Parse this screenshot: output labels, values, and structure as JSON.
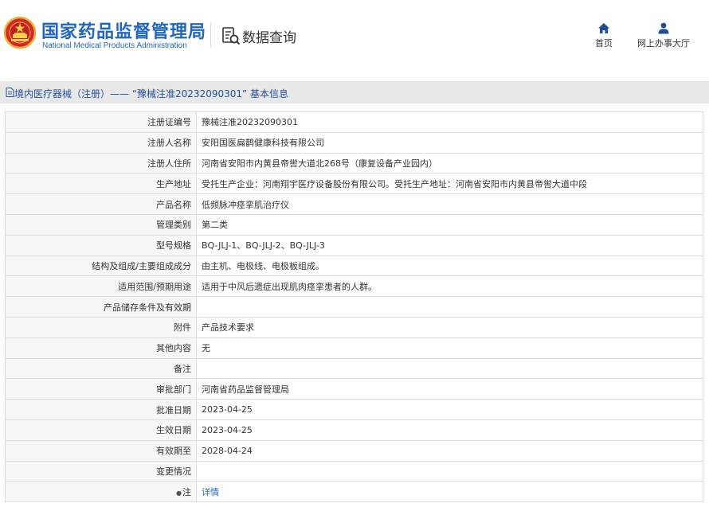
{
  "header": {
    "title_cn": "国家药品监督管理局",
    "title_en": "National Medical Products Administration",
    "query_title": "数据查询",
    "nav": {
      "home": "首页",
      "service_hall": "网上办事大厅"
    }
  },
  "breadcrumb": {
    "text": "境内医疗器械（注册）—— “豫械注准20232090301” 基本信息"
  },
  "rows": [
    {
      "label": "注册证编号",
      "value": "豫械注准20232090301"
    },
    {
      "label": "注册人名称",
      "value": "安阳国医扁鹊健康科技有限公司"
    },
    {
      "label": "注册人住所",
      "value": "河南省安阳市内黄县帝喾大道北268号（康复设备产业园内）"
    },
    {
      "label": "生产地址",
      "value": "受托生产企业：河南翔宇医疗设备股份有限公司。受托生产地址：河南省安阳市内黄县帝喾大道中段"
    },
    {
      "label": "产品名称",
      "value": "低频脉冲痉挛肌治疗仪"
    },
    {
      "label": "管理类别",
      "value": "第二类"
    },
    {
      "label": "型号规格",
      "value": "BQ-JLJ-1、BQ-JLJ-2、BQ-JLJ-3"
    },
    {
      "label": "结构及组成/主要组成成分",
      "value": "由主机、电极线、电极板组成。"
    },
    {
      "label": "适用范围/预期用途",
      "value": "适用于中风后遗症出现肌肉痉挛患者的人群。"
    },
    {
      "label": "产品储存条件及有效期",
      "value": ""
    },
    {
      "label": "附件",
      "value": "产品技术要求"
    },
    {
      "label": "其他内容",
      "value": "无"
    },
    {
      "label": "备注",
      "value": ""
    },
    {
      "label": "审批部门",
      "value": "河南省药品监督管理局"
    },
    {
      "label": "批准日期",
      "value": "2023-04-25"
    },
    {
      "label": "生效日期",
      "value": "2023-04-25"
    },
    {
      "label": "有效期至",
      "value": "2028-04-24"
    },
    {
      "label": "变更情况",
      "value": ""
    },
    {
      "label": "注",
      "value": "详情"
    }
  ],
  "icons": {
    "emblem": "national-emblem-icon",
    "query": "document-search-icon",
    "home": "home-icon",
    "hall": "user-icon",
    "breadcrumb": "document-icon",
    "note": "pin-icon"
  },
  "colors": {
    "brand_blue": "#1f66c1",
    "title_bar_bg": "#e8e8e8",
    "label_bg": "#f7f7f7",
    "border": "#dddddd"
  }
}
